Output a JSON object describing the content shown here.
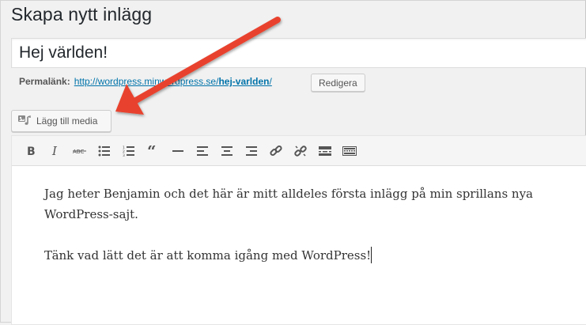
{
  "page": {
    "title": "Skapa nytt inlägg"
  },
  "post": {
    "title_value": "Hej världen!",
    "permalink_label": "Permalänk:",
    "permalink_base": "http://wordpress.minwordpress.se/",
    "permalink_slug": "hej-varlden",
    "permalink_trailing": "/",
    "edit_label": "Redigera"
  },
  "media": {
    "add_label": "Lägg till media"
  },
  "toolbar": {
    "buttons": [
      "bold-icon",
      "italic-icon",
      "strikethrough-icon",
      "bullet-list-icon",
      "numbered-list-icon",
      "blockquote-icon",
      "horizontal-rule-icon",
      "align-left-icon",
      "align-center-icon",
      "align-right-icon",
      "insert-link-icon",
      "remove-link-icon",
      "read-more-icon",
      "toolbar-toggle-icon"
    ]
  },
  "content": {
    "paragraphs": [
      "Jag heter Benjamin och det här är mitt alldeles första inlägg på min sprillans nya WordPress-sajt.",
      "Tänk vad lätt det är att komma igång med WordPress!"
    ]
  },
  "colors": {
    "link": "#0073aa",
    "arrow": "#e8432f",
    "text": "#23282d"
  }
}
